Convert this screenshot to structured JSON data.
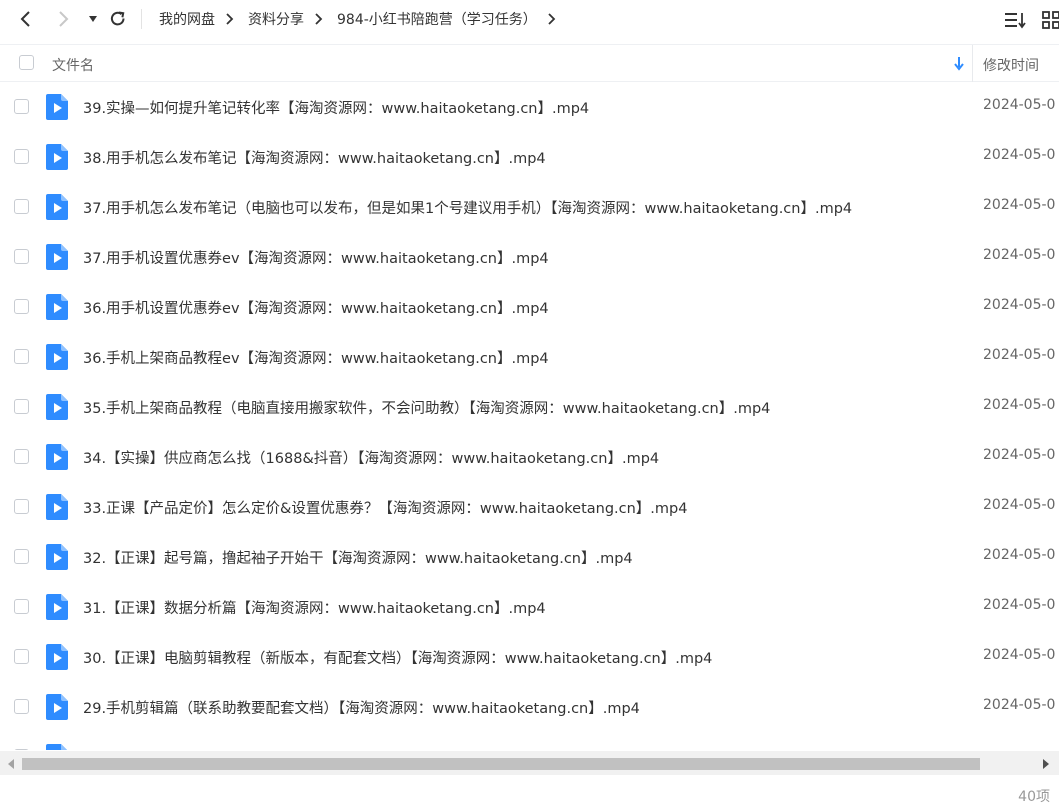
{
  "nav": {
    "back_icon": "chevron-left-icon",
    "forward_icon": "chevron-right-icon",
    "history_icon": "caret-down-icon",
    "refresh_icon": "refresh-icon"
  },
  "breadcrumb": [
    {
      "label": "我的网盘"
    },
    {
      "label": "资料分享"
    },
    {
      "label": "984-小红书陪跑营（学习任务）"
    }
  ],
  "header": {
    "name_label": "文件名",
    "time_label": "修改时间"
  },
  "files": [
    {
      "name": "39.实操—如何提升笔记转化率【海淘资源网：www.haitaoketang.cn】.mp4",
      "time": "2024-05-0"
    },
    {
      "name": "38.用手机怎么发布笔记【海淘资源网：www.haitaoketang.cn】.mp4",
      "time": "2024-05-0"
    },
    {
      "name": "37.用手机怎么发布笔记（电脑也可以发布，但是如果1个号建议用手机）【海淘资源网：www.haitaoketang.cn】.mp4",
      "time": "2024-05-0"
    },
    {
      "name": "37.用手机设置优惠券ev【海淘资源网：www.haitaoketang.cn】.mp4",
      "time": "2024-05-0"
    },
    {
      "name": "36.用手机设置优惠券ev【海淘资源网：www.haitaoketang.cn】.mp4",
      "time": "2024-05-0"
    },
    {
      "name": "36.手机上架商品教程ev【海淘资源网：www.haitaoketang.cn】.mp4",
      "time": "2024-05-0"
    },
    {
      "name": "35.手机上架商品教程（电脑直接用搬家软件，不会问助教）【海淘资源网：www.haitaoketang.cn】.mp4",
      "time": "2024-05-0"
    },
    {
      "name": "34.【实操】供应商怎么找（1688&抖音）【海淘资源网：www.haitaoketang.cn】.mp4",
      "time": "2024-05-0"
    },
    {
      "name": "33.正课【产品定价】怎么定价&设置优惠券？【海淘资源网：www.haitaoketang.cn】.mp4",
      "time": "2024-05-0"
    },
    {
      "name": "32.【正课】起号篇，撸起袖子开始干【海淘资源网：www.haitaoketang.cn】.mp4",
      "time": "2024-05-0"
    },
    {
      "name": "31.【正课】数据分析篇【海淘资源网：www.haitaoketang.cn】.mp4",
      "time": "2024-05-0"
    },
    {
      "name": "30.【正课】电脑剪辑教程（新版本，有配套文档）【海淘资源网：www.haitaoketang.cn】.mp4",
      "time": "2024-05-0"
    },
    {
      "name": "29.手机剪辑篇（联系助教要配套文档）【海淘资源网：www.haitaoketang.cn】.mp4",
      "time": "2024-05-0"
    },
    {
      "name": "",
      "time": ""
    }
  ],
  "footer": {
    "count": "40项"
  },
  "colors": {
    "accent": "#2f8cff",
    "video_icon": "#2f8cff",
    "text": "#333333",
    "muted": "#666666"
  }
}
